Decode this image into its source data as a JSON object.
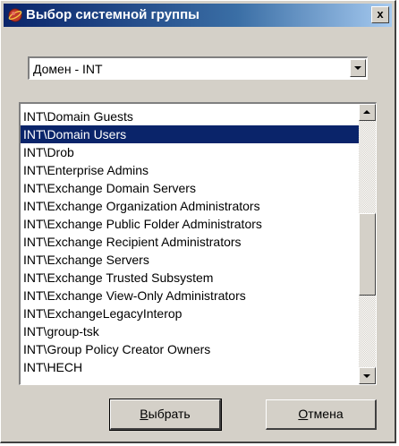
{
  "window": {
    "title": "Выбор системной группы",
    "close_label": "x"
  },
  "icons": {
    "title": "app-globe-icon",
    "close": "close-icon",
    "combo_arrow": "chevron-down-icon",
    "scroll_up": "scroll-up-icon",
    "scroll_down": "scroll-down-icon"
  },
  "colors": {
    "selection": "#0a246a",
    "face": "#d4d0c8"
  },
  "domain_combo": {
    "value": "Домен - INT"
  },
  "group_list": {
    "items": [
      "INT\\Domain Guests",
      "INT\\Domain Users",
      "INT\\Drob",
      "INT\\Enterprise Admins",
      "INT\\Exchange Domain Servers",
      "INT\\Exchange Organization Administrators",
      "INT\\Exchange Public Folder Administrators",
      "INT\\Exchange Recipient Administrators",
      "INT\\Exchange Servers",
      "INT\\Exchange Trusted Subsystem",
      "INT\\Exchange View-Only Administrators",
      "INT\\ExchangeLegacyInterop",
      "INT\\group-tsk",
      "INT\\Group Policy Creator Owners",
      "INT\\HECH"
    ],
    "selected_index": 1
  },
  "buttons": {
    "select_mnemonic": "В",
    "select_rest": "ыбрать",
    "cancel_mnemonic": "О",
    "cancel_rest": "тмена"
  }
}
